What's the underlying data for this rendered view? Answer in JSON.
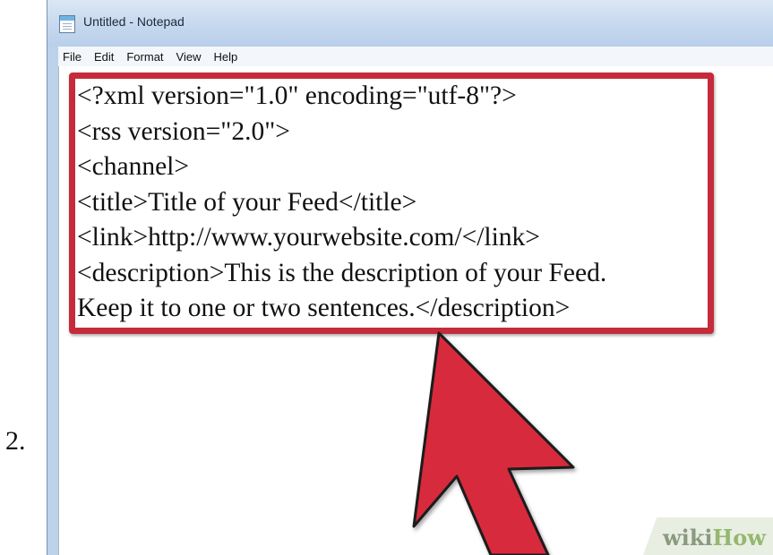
{
  "step_number": "2.",
  "window": {
    "title": "Untitled - Notepad",
    "icon": "notepad-icon"
  },
  "menu": {
    "items": [
      {
        "label": "File"
      },
      {
        "label": "Edit"
      },
      {
        "label": "Format"
      },
      {
        "label": "View"
      },
      {
        "label": "Help"
      }
    ]
  },
  "editor": {
    "lines": [
      "<?xml version=\"1.0\" encoding=\"utf-8\"?>",
      "<rss version=\"2.0\">",
      "<channel>",
      "<title>Title of your Feed</title>",
      "<link>http://www.yourwebsite.com/</link>",
      "<description>This is the description of your Feed.",
      "Keep it to one or two sentences.</description>"
    ]
  },
  "annotation": {
    "highlight_color": "#c62b3b",
    "arrow_color": "#d82a3c",
    "arrow_icon": "pointer-arrow-icon"
  },
  "watermark": {
    "part1": "wiki",
    "part2": "How"
  }
}
